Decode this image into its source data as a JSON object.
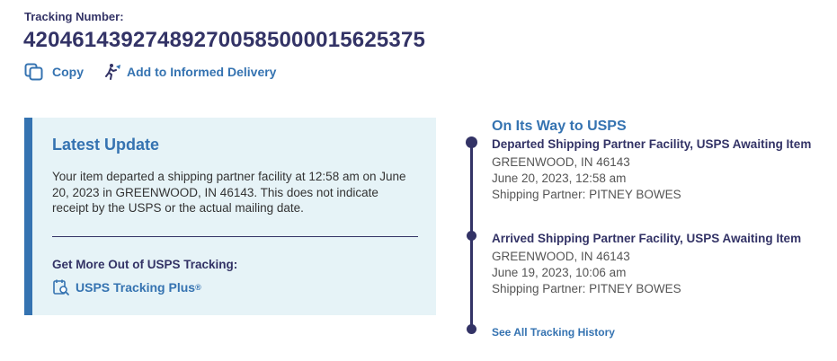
{
  "tracking": {
    "label": "Tracking Number:",
    "number": "420461439274892700585000015625375"
  },
  "actions": {
    "copy": "Copy",
    "informed_delivery": "Add to Informed Delivery"
  },
  "latest_update": {
    "title": "Latest Update",
    "text": "Your item departed a shipping partner facility at 12:58 am on June 20, 2023 in GREENWOOD, IN 46143. This does not indicate receipt by the USPS or the actual mailing date.",
    "more_title": "Get More Out of USPS Tracking:",
    "plus_link": "USPS Tracking Plus",
    "plus_mark": "®"
  },
  "timeline": {
    "status": "On Its Way to USPS",
    "events": [
      {
        "title": "Departed Shipping Partner Facility, USPS Awaiting Item",
        "location": "GREENWOOD, IN 46143",
        "datetime": "June 20, 2023, 12:58 am",
        "partner": "Shipping Partner: PITNEY BOWES"
      },
      {
        "title": "Arrived Shipping Partner Facility, USPS Awaiting Item",
        "location": "GREENWOOD, IN 46143",
        "datetime": "June 19, 2023, 10:06 am",
        "partner": "Shipping Partner: PITNEY BOWES"
      }
    ],
    "history_link": "See All Tracking History"
  },
  "colors": {
    "navy": "#333366",
    "link_blue": "#3573b1",
    "panel_bg": "#e6f3f7"
  },
  "icons": [
    "copy-icon",
    "informed-delivery-icon",
    "tracking-plus-icon"
  ]
}
